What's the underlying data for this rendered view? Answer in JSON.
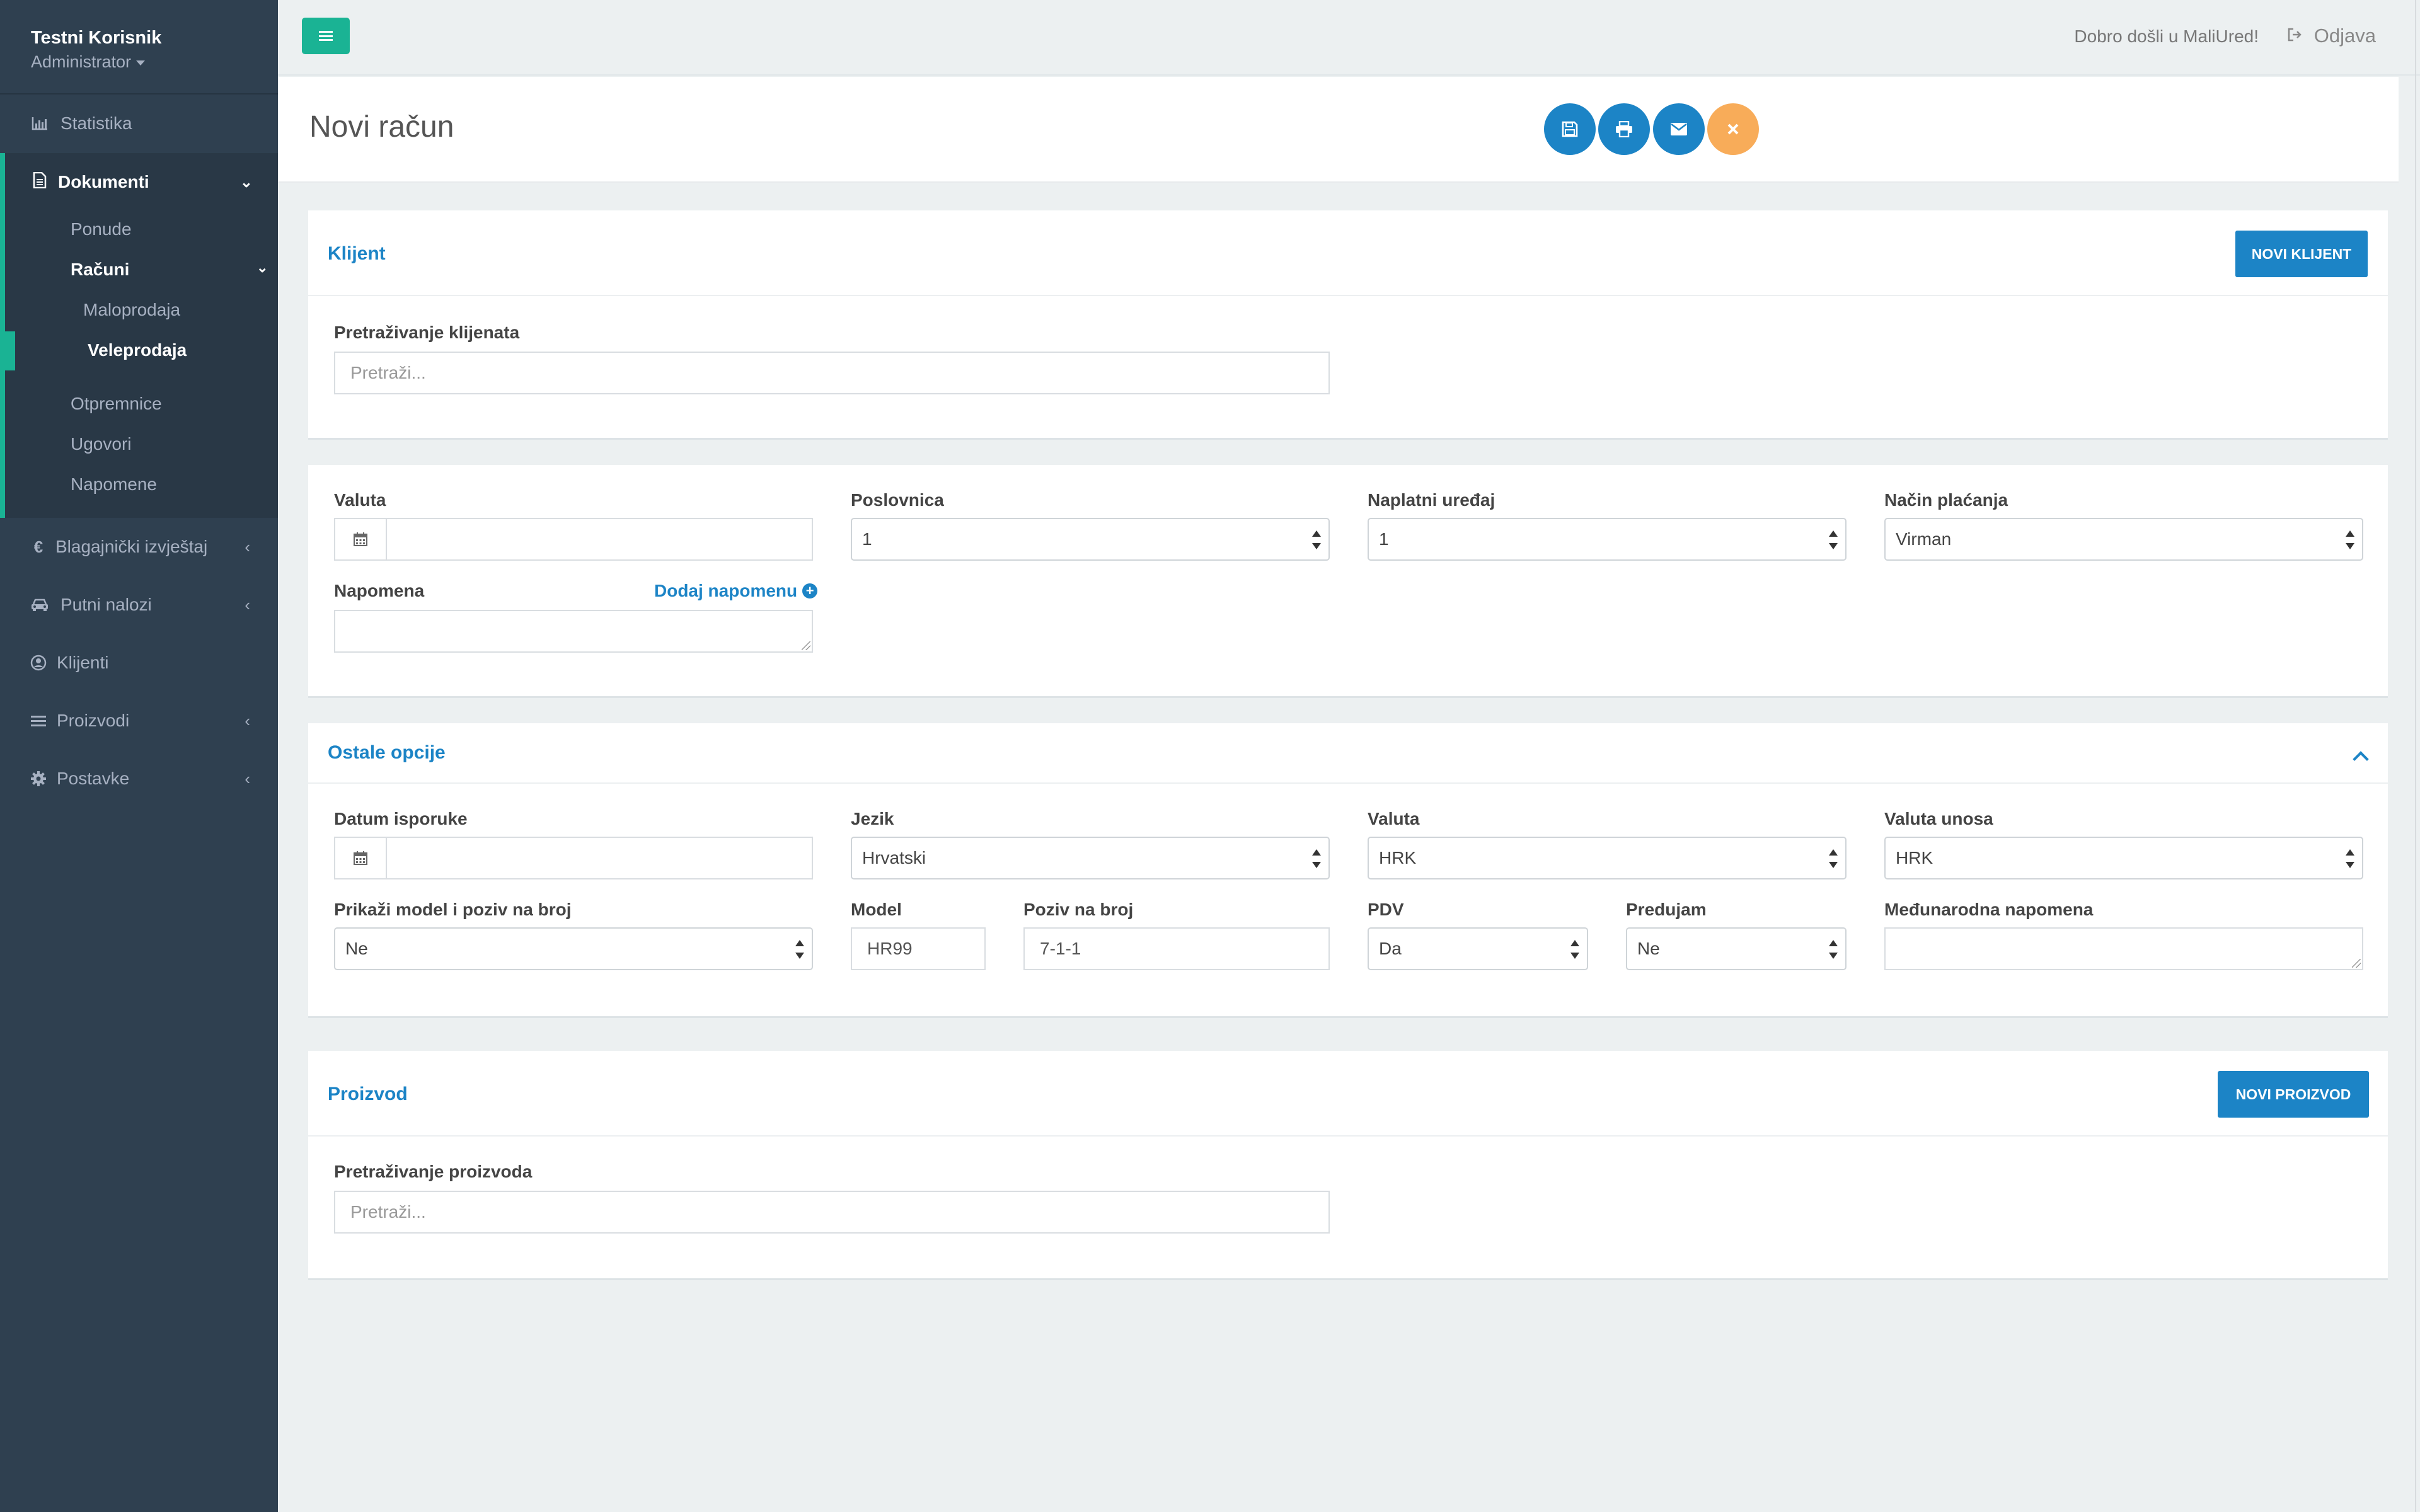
{
  "user": {
    "name": "Testni Korisnik",
    "role": "Administrator"
  },
  "nav": {
    "statistika": "Statistika",
    "dokumenti": "Dokumenti",
    "ponude": "Ponude",
    "racuni": "Računi",
    "maloprodaja": "Maloprodaja",
    "veleprodaja": "Veleprodaja",
    "otpremnice": "Otpremnice",
    "ugovori": "Ugovori",
    "napomene": "Napomene",
    "blagajnicki": "Blagajnički izvještaj",
    "putni": "Putni nalozi",
    "klijenti": "Klijenti",
    "proizvodi": "Proizvodi",
    "postavke": "Postavke"
  },
  "topbar": {
    "welcome": "Dobro došli u MaliUred!",
    "logout": "Odjava"
  },
  "page": {
    "title": "Novi račun"
  },
  "icons": {
    "bar_chart": "bar-chart-icon",
    "document": "file-icon",
    "euro": "€",
    "car": "car-icon",
    "user": "user-circle-icon",
    "list": "list-icon",
    "gear": "gear-icon",
    "save": "save-icon",
    "print": "print-icon",
    "email": "envelope-icon",
    "close": "close-icon"
  },
  "colors": {
    "sidebar": "#2f4050",
    "accent_green": "#1ab394",
    "primary_blue": "#1c84c6",
    "warning_orange": "#f8ac59"
  },
  "klijent": {
    "title": "Klijent",
    "new_button": "NOVI KLIJENT",
    "search_label": "Pretraživanje klijenata",
    "search_placeholder": "Pretraži..."
  },
  "detalji": {
    "valuta_label": "Valuta",
    "valuta_value": "",
    "poslovnica_label": "Poslovnica",
    "poslovnica_value": "1",
    "naplatni_label": "Naplatni uređaj",
    "naplatni_value": "1",
    "nacin_label": "Način plaćanja",
    "nacin_value": "Virman",
    "napomena_label": "Napomena",
    "dodaj_napomenu": "Dodaj napomenu"
  },
  "ostale": {
    "title": "Ostale opcije",
    "datum_label": "Datum isporuke",
    "datum_value": "",
    "jezik_label": "Jezik",
    "jezik_value": "Hrvatski",
    "valuta_label": "Valuta",
    "valuta_value": "HRK",
    "valuta_unosa_label": "Valuta unosa",
    "valuta_unosa_value": "HRK",
    "prikazi_label": "Prikaži model i poziv na broj",
    "prikazi_value": "Ne",
    "model_label": "Model",
    "model_value": "HR99",
    "poziv_label": "Poziv na broj",
    "poziv_value": "7-1-1",
    "pdv_label": "PDV",
    "pdv_value": "Da",
    "predujam_label": "Predujam",
    "predujam_value": "Ne",
    "medunarodna_label": "Međunarodna napomena"
  },
  "proizvod": {
    "title": "Proizvod",
    "new_button": "NOVI PROIZVOD",
    "search_label": "Pretraživanje proizvoda",
    "search_placeholder": "Pretraži..."
  }
}
